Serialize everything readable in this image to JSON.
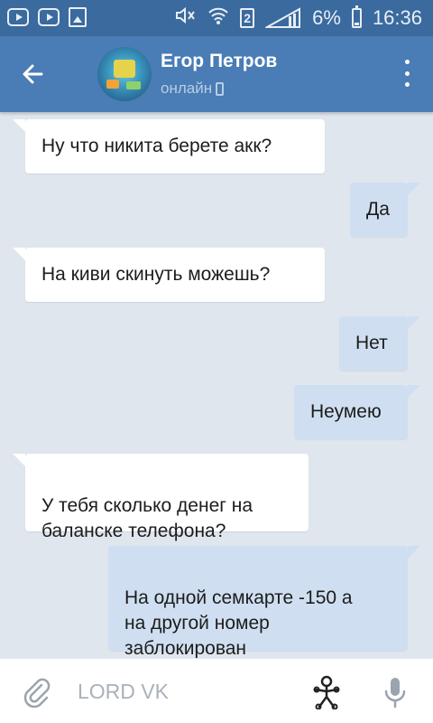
{
  "statusbar": {
    "battery": "6%",
    "time": "16:36",
    "sim_slot": "2",
    "icons": [
      "youtube-icon",
      "youtube-icon",
      "gallery-icon",
      "mute-icon",
      "wifi-icon",
      "sim-2-icon",
      "signal-icon",
      "battery-icon"
    ]
  },
  "header": {
    "contact_name": "Егор Петров",
    "status": "онлайн",
    "back_icon": "arrow-left-icon",
    "menu_icon": "more-vert-icon",
    "status_icon": "mobile-phone-icon"
  },
  "messages": [
    {
      "direction": "in",
      "text": "Ну что никита берете акк?"
    },
    {
      "direction": "out",
      "text": "Да"
    },
    {
      "direction": "in",
      "text": "На киви скинуть можешь?"
    },
    {
      "direction": "out",
      "text": "Нет"
    },
    {
      "direction": "out",
      "text": "Неумею"
    },
    {
      "direction": "in",
      "text": "У тебя сколько денег на\nбаланске телефона?"
    },
    {
      "direction": "out",
      "text": "На одной семкарте -150 а\nна другой номер\nзаблокирован"
    }
  ],
  "composer": {
    "placeholder": "LORD VK",
    "attach_icon": "paperclip-icon",
    "sticker_icon": "sticker-icon",
    "mic_icon": "microphone-icon"
  },
  "colors": {
    "statusbar": "#3a6a9e",
    "appbar": "#4a7cb5",
    "background": "#dfe6ee",
    "incoming_bubble": "#ffffff",
    "outgoing_bubble": "#cfdff1"
  }
}
